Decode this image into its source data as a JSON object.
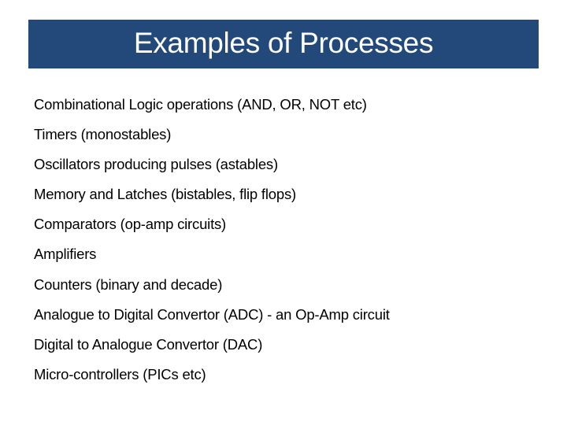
{
  "slide": {
    "title": "Examples of Processes",
    "banner_color": "#23497a",
    "items": [
      "Combinational Logic operations (AND, OR, NOT etc)",
      "Timers (monostables)",
      "Oscillators producing pulses (astables)",
      "Memory and Latches (bistables, flip flops)",
      "Comparators (op-amp circuits)",
      "Amplifiers",
      "Counters (binary and decade)",
      "Analogue to Digital Convertor (ADC) - an Op-Amp circuit",
      "Digital to Analogue Convertor (DAC)",
      "Micro-controllers (PICs etc)"
    ]
  }
}
